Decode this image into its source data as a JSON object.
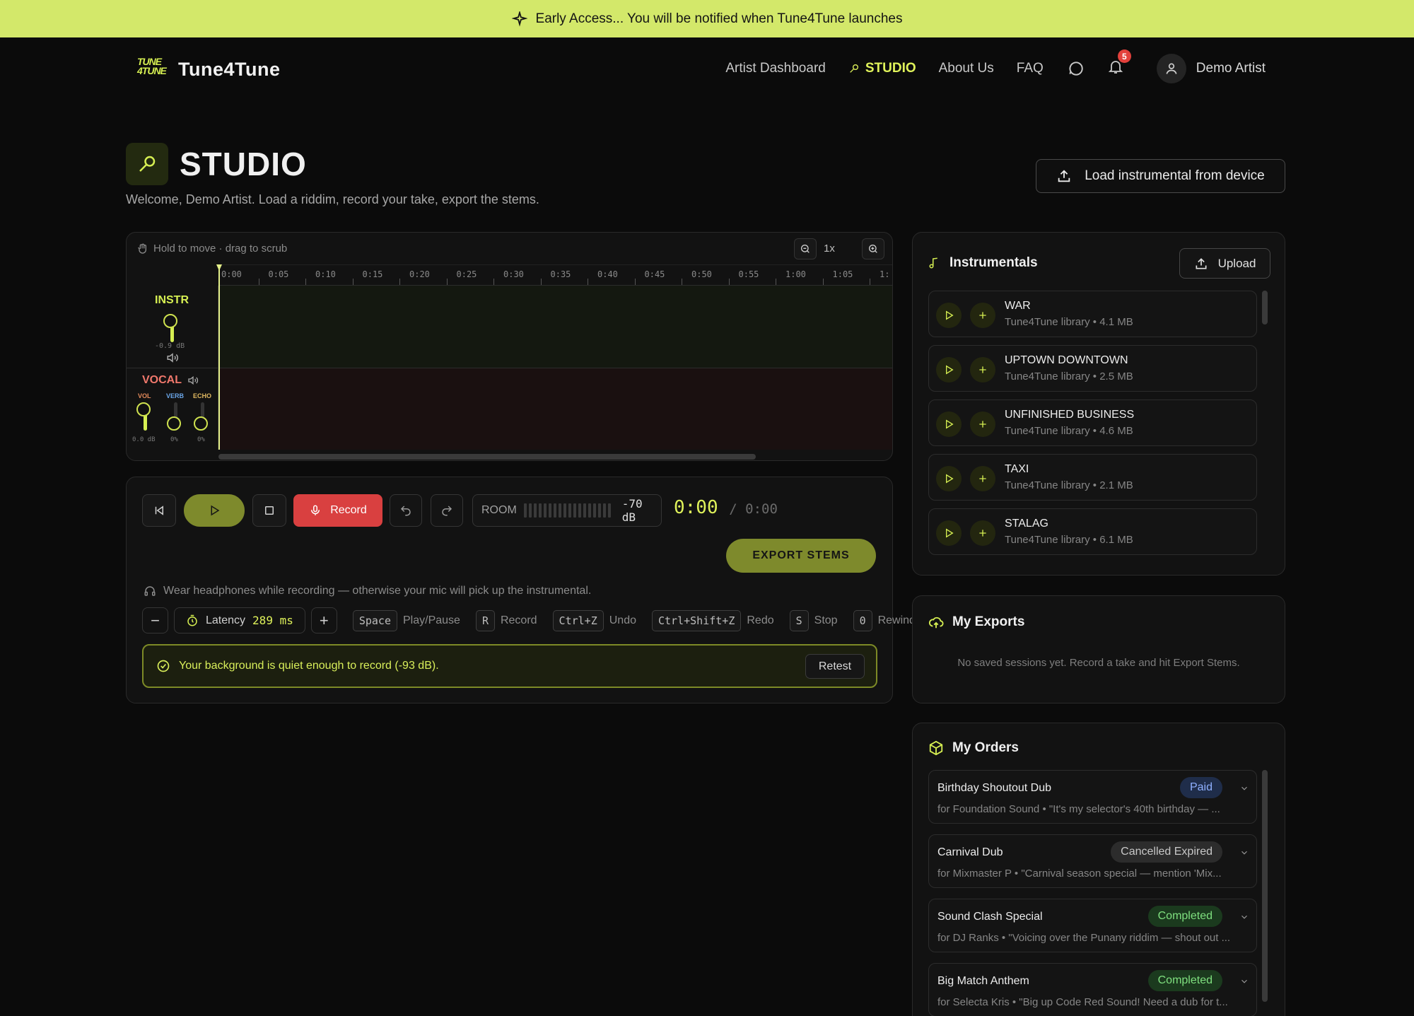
{
  "banner": {
    "text": "Early Access... You will be notified when Tune4Tune launches"
  },
  "brand": {
    "mark": "TUNE 4TUNE",
    "name": "Tune4Tune",
    "accent": "#d6ef52"
  },
  "nav": {
    "links": [
      "Artist Dashboard",
      "STUDIO",
      "About Us",
      "FAQ"
    ],
    "notifications": "5",
    "user": "Demo Artist"
  },
  "studio": {
    "title": "STUDIO",
    "subtitle": "Welcome, Demo Artist. Load a riddim, record your take, export the stems.",
    "load_button": "Load instrumental from device"
  },
  "timeline": {
    "hint": "Hold to move · drag to scrub",
    "zoom_level": "1x",
    "ticks": [
      "0:00",
      "0:05",
      "0:10",
      "0:15",
      "0:20",
      "0:25",
      "0:30",
      "0:35",
      "0:40",
      "0:45",
      "0:50",
      "0:55",
      "1:00",
      "1:05",
      "1:"
    ],
    "instr": {
      "label": "INSTR",
      "db": "-0.9 dB"
    },
    "vocal": {
      "label": "VOCAL",
      "vol": "VOL",
      "verb": "VERB",
      "echo": "ECHO",
      "vol_val": "0.0 dB",
      "verb_val": "0%",
      "echo_val": "0%"
    }
  },
  "transport": {
    "record": "Record",
    "room_label": "ROOM",
    "room_db": "-70 dB",
    "time_current": "0:00",
    "time_total": "/ 0:00",
    "export": "EXPORT STEMS",
    "headphones_note": "Wear headphones while recording — otherwise your mic will pick up the instrumental.",
    "latency_label": "Latency",
    "latency_value": "289 ms",
    "minus": "−",
    "plus": "+",
    "shortcuts": [
      {
        "key": "Space",
        "label": "Play/Pause"
      },
      {
        "key": "R",
        "label": "Record"
      },
      {
        "key": "Ctrl+Z",
        "label": "Undo"
      },
      {
        "key": "Ctrl+Shift+Z",
        "label": "Redo"
      },
      {
        "key": "S",
        "label": "Stop"
      },
      {
        "key": "0",
        "label": "Rewind"
      }
    ],
    "quiet_msg": "Your background is quiet enough to record (-93 dB).",
    "retest": "Retest"
  },
  "instrumentals": {
    "title": "Instrumentals",
    "upload": "Upload",
    "items": [
      {
        "name": "WAR",
        "meta": "Tune4Tune library • 4.1 MB"
      },
      {
        "name": "UPTOWN DOWNTOWN",
        "meta": "Tune4Tune library • 2.5 MB"
      },
      {
        "name": "UNFINISHED BUSINESS",
        "meta": "Tune4Tune library • 4.6 MB"
      },
      {
        "name": "TAXI",
        "meta": "Tune4Tune library • 2.1 MB"
      },
      {
        "name": "STALAG",
        "meta": "Tune4Tune library • 6.1 MB"
      }
    ]
  },
  "exports": {
    "title": "My Exports",
    "empty": "No saved sessions yet. Record a take and hit Export Stems."
  },
  "orders": {
    "title": "My Orders",
    "items": [
      {
        "name": "Birthday Shoutout Dub",
        "status": "Paid",
        "meta": "for Foundation Sound • \"It's my selector's 40th birthday — ..."
      },
      {
        "name": "Carnival Dub",
        "status": "Cancelled Expired",
        "meta": "for Mixmaster P • \"Carnival season special — mention 'Mix..."
      },
      {
        "name": "Sound Clash Special",
        "status": "Completed",
        "meta": "for DJ Ranks • \"Voicing over the Punany riddim — shout out ..."
      },
      {
        "name": "Big Match Anthem",
        "status": "Completed",
        "meta": "for Selecta Kris • \"Big up Code Red Sound! Need a dub for t..."
      }
    ]
  }
}
